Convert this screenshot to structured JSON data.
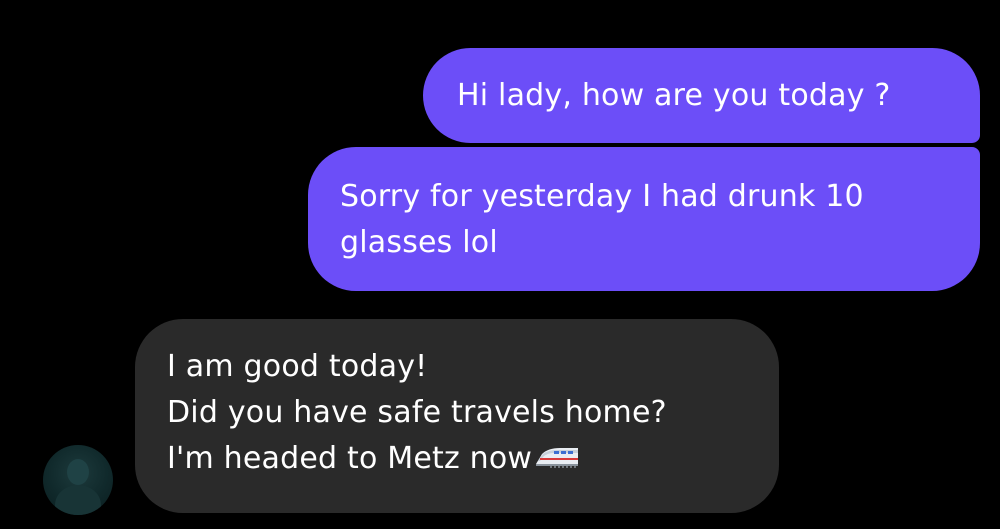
{
  "conversation": {
    "messages": [
      {
        "direction": "sent",
        "lines": [
          "Hi lady, how are you today ?"
        ]
      },
      {
        "direction": "sent",
        "lines": [
          "Sorry for yesterday I had drunk 10",
          "glasses lol"
        ]
      },
      {
        "direction": "received",
        "lines": [
          "I am good today!",
          "Did you have safe travels home?",
          "I'm headed to Metz now"
        ],
        "emoji": "high-speed-train-icon"
      }
    ]
  },
  "colors": {
    "background": "#000000",
    "sent_bubble": "#6c4ef8",
    "received_bubble": "#2a2a2a",
    "text": "#ffffff"
  }
}
